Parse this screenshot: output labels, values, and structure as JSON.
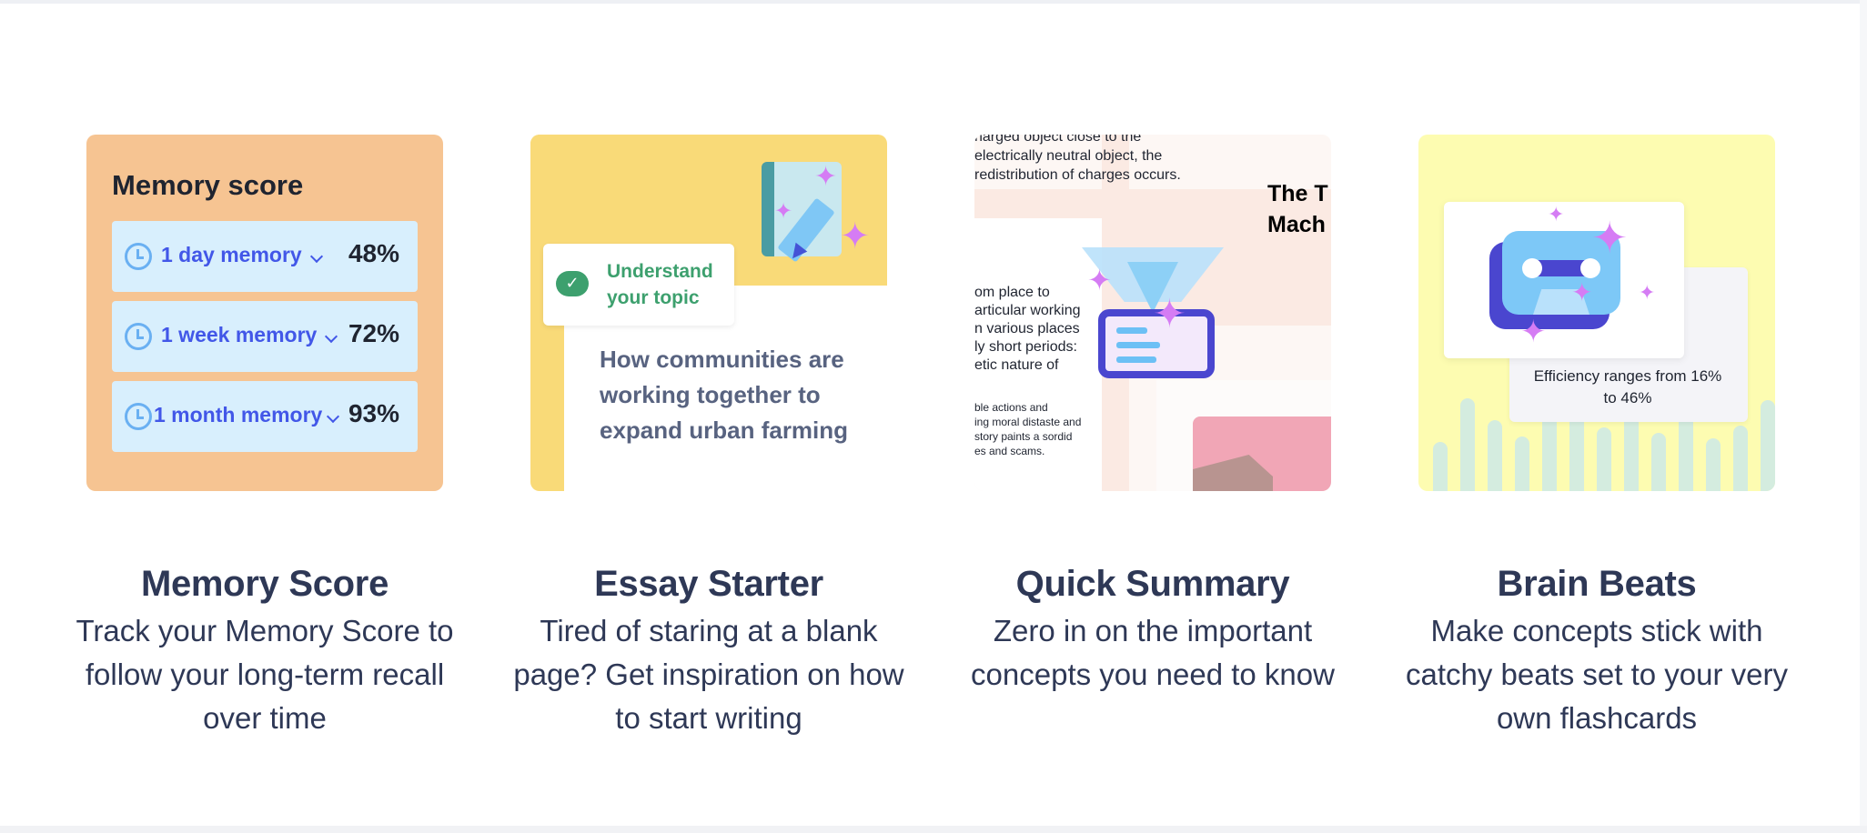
{
  "features": [
    {
      "title": "Memory Score",
      "description": "Track your Memory Score to follow your long-term recall over time",
      "card": {
        "heading": "Memory score",
        "rows": [
          {
            "label": "1 day memory",
            "percent": "48%"
          },
          {
            "label": "1 week memory",
            "percent": "72%"
          },
          {
            "label": "1 month memory",
            "percent": "93%"
          }
        ]
      }
    },
    {
      "title": "Essay Starter",
      "description": "Tired of staring at a blank page? Get inspiration on how to start writing",
      "card": {
        "badge": "Understand your topic",
        "prompt": "How communities are working together to expand urban farming"
      }
    },
    {
      "title": "Quick Summary",
      "description": "Zero in on the important concepts you need to know",
      "card": {
        "text_top": "harged object close to the\nelectrically neutral object, the\nredistribution of charges occurs.",
        "text_mid": "om place to\narticular working\nn various places\nly short periods:\netic nature of",
        "text_bottom": "ble actions and\ning moral distaste and\nstory paints a sordid\nes and scams.",
        "heading_fragment": "The T\nMach"
      }
    },
    {
      "title": "Brain Beats",
      "description": "Make concepts stick with catchy beats set to your very own flashcards",
      "card": {
        "caption": "Efficiency ranges from 16% to 46%"
      }
    }
  ],
  "colors": {
    "memory_card_bg": "#f6c492",
    "essay_card_bg": "#f9da78",
    "brain_card_bg": "#fdfcb1",
    "accent_blue": "#4257e8",
    "accent_green": "#3da06e",
    "sparkle": "#d57cf4",
    "text_dark": "#2e3856"
  },
  "icons": [
    "clock-icon",
    "chevron-down-icon",
    "check-icon",
    "notebook-icon",
    "pencil-icon",
    "sparkle-icon",
    "funnel-icon",
    "document-icon",
    "cassette-tape-icon"
  ]
}
